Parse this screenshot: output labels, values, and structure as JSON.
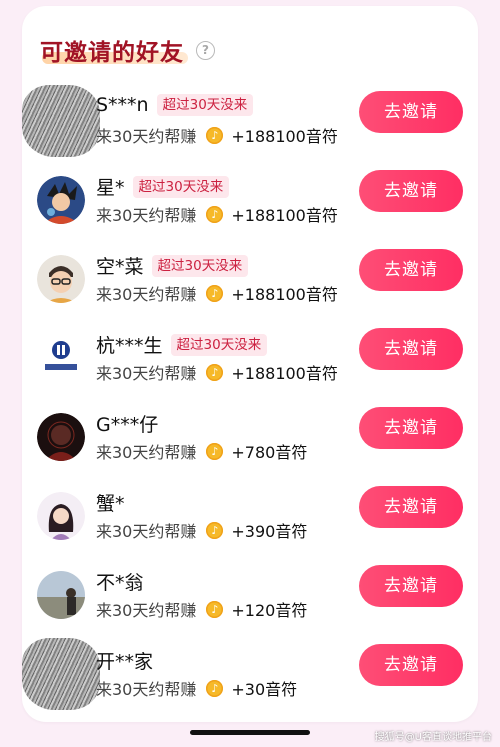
{
  "header": {
    "title": "可邀请的好友",
    "help_icon": "?"
  },
  "invite_rows": [
    {
      "name": "S***n",
      "badge": "超过30天没来",
      "subtitle": "来30天约帮赚",
      "reward": "+188100音符",
      "button": "去邀请",
      "avatar": "scribble"
    },
    {
      "name": "星*",
      "badge": "超过30天没来",
      "subtitle": "来30天约帮赚",
      "reward": "+188100音符",
      "button": "去邀请",
      "avatar": "anime"
    },
    {
      "name": "空*菜",
      "badge": "超过30天没来",
      "subtitle": "来30天约帮赚",
      "reward": "+188100音符",
      "button": "去邀请",
      "avatar": "glasses"
    },
    {
      "name": "杭***生",
      "badge": "超过30天没来",
      "subtitle": "来30天约帮赚",
      "reward": "+188100音符",
      "button": "去邀请",
      "avatar": "logo"
    },
    {
      "name": "G***仔",
      "badge": "",
      "subtitle": "来30天约帮赚",
      "reward": "+780音符",
      "button": "去邀请",
      "avatar": "dark"
    },
    {
      "name": "蟹*",
      "badge": "",
      "subtitle": "来30天约帮赚",
      "reward": "+390音符",
      "button": "去邀请",
      "avatar": "girl"
    },
    {
      "name": "不*翁",
      "badge": "",
      "subtitle": "来30天约帮赚",
      "reward": "+120音符",
      "button": "去邀请",
      "avatar": "landscape"
    },
    {
      "name": "开**家",
      "badge": "",
      "subtitle": "来30天约帮赚",
      "reward": "+30音符",
      "button": "去邀请",
      "avatar": "scribble"
    }
  ],
  "watermark": "搜狐号@U客直谈地推平台",
  "colors": {
    "accent": "#ff3b6b",
    "title": "#a11325",
    "badge_bg": "#fde7ec",
    "badge_text": "#cc2241",
    "coin": "#f6b929"
  }
}
